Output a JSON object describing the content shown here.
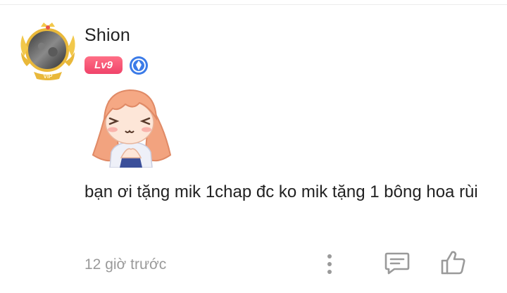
{
  "comment": {
    "user": {
      "name": "Shion",
      "level_label": "Lv9",
      "avatar_frame_label": "VIP"
    },
    "text": "bạn ơi tặng mik 1chap đc ko mik tặng 1 bông hoa rùi",
    "timestamp": "12 giờ trước"
  },
  "actions": {
    "more_icon": "more-vertical-icon",
    "reply_icon": "comment-icon",
    "like_icon": "thumbs-up-icon"
  },
  "colors": {
    "level_badge": "#f0436a",
    "verify_badge": "#3b7be8",
    "avatar_frame_gold": "#e9b83a",
    "icon_gray": "#9a9a9a"
  }
}
